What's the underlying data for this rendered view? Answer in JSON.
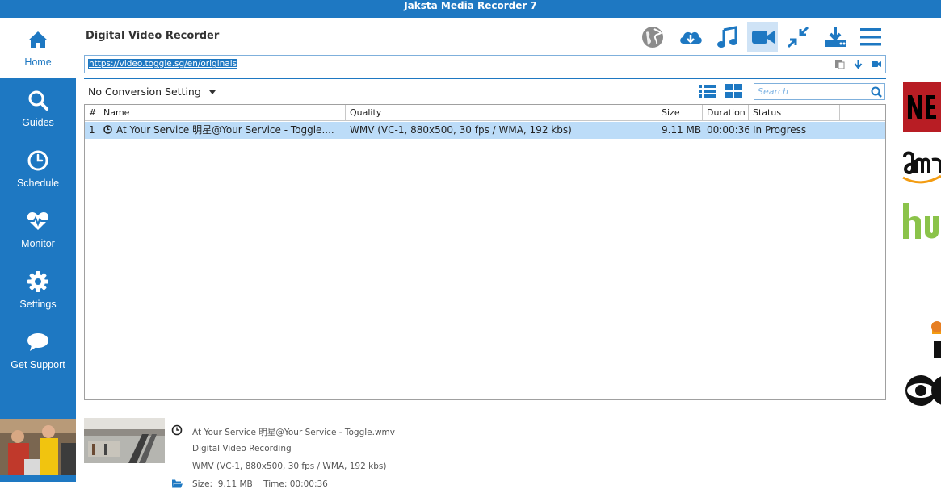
{
  "window": {
    "title": "Jaksta Media Recorder 7"
  },
  "sidebar": {
    "items": [
      {
        "label": "Home",
        "icon": "home-icon",
        "active": true
      },
      {
        "label": "Guides",
        "icon": "search-icon"
      },
      {
        "label": "Schedule",
        "icon": "clock-icon"
      },
      {
        "label": "Monitor",
        "icon": "heart-pulse-icon"
      },
      {
        "label": "Settings",
        "icon": "gear-icon"
      },
      {
        "label": "Get Support",
        "icon": "chat-bubble-icon"
      }
    ]
  },
  "header": {
    "title": "Digital Video Recorder"
  },
  "toolbar": {
    "icons": [
      "globe-icon",
      "cloud-download-icon",
      "music-icon",
      "video-camera-icon",
      "compress-icon",
      "download-tray-icon",
      "hamburger-menu-icon"
    ],
    "active": "video-camera-icon"
  },
  "url_bar": {
    "value": "https://video.toggle.sg/en/originals"
  },
  "conversion": {
    "selected": "No Conversion Setting"
  },
  "search": {
    "placeholder": "Search"
  },
  "table": {
    "columns": [
      "#",
      "Name",
      "Quality",
      "Size",
      "Duration",
      "Status"
    ],
    "rows": [
      {
        "num": "1",
        "name": "At Your Service 明星@Your Service - Toggle....",
        "quality": "WMV (VC-1, 880x500, 30 fps / WMA, 192 kbs)",
        "size": "9.11 MB",
        "duration": "00:00:36",
        "status": "In Progress"
      }
    ]
  },
  "details": {
    "filename": "At Your Service 明星@Your Service - Toggle.wmv",
    "type": "Digital Video Recording",
    "format": "WMV (VC-1, 880x500, 30 fps / WMA, 192 kbs)",
    "size_label": "Size:",
    "size": "9.11 MB",
    "time_label": "Time:",
    "time": "00:00:36"
  },
  "colors": {
    "accent": "#1e78c2",
    "selection": "#bcdcf8"
  }
}
